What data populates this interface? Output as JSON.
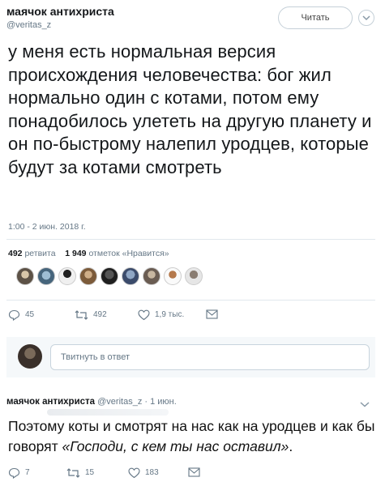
{
  "tweet": {
    "author_name": "маячок антихриста",
    "author_handle": "@veritas_z",
    "follow_label": "Читать",
    "text": "у меня есть нормальная версия происхождения человечества: бог жил нормально один с котами, потом ему понадобилось улететь на другую планету и он по-быстрому налепил уродцев, которые будут за котами смотреть",
    "timestamp": "1:00 - 2 июн. 2018 г.",
    "stats": {
      "retweets_count": "492",
      "retweets_label": "ретвита",
      "likes_count": "1 949",
      "likes_label": "отметок «Нравится»"
    },
    "actions": {
      "replies": "45",
      "retweets": "492",
      "likes": "1,9 тыс."
    }
  },
  "reply_box": {
    "placeholder": "Твитнуть в ответ"
  },
  "reply": {
    "author_name": "маячок антихриста",
    "meta": "@veritas_z · 1 июн.",
    "text_plain": "Поэтому коты и смотрят на нас как на уродцев и как бы говорят ",
    "text_quote": "«Господи, с кем ты нас оставил»",
    "text_end": ".",
    "actions": {
      "replies": "7",
      "retweets": "15",
      "likes": "183"
    }
  },
  "colors": {
    "text": "#14171a",
    "muted": "#657786",
    "divider": "#e1e8ed",
    "reply_bg": "#f5f8fa"
  }
}
